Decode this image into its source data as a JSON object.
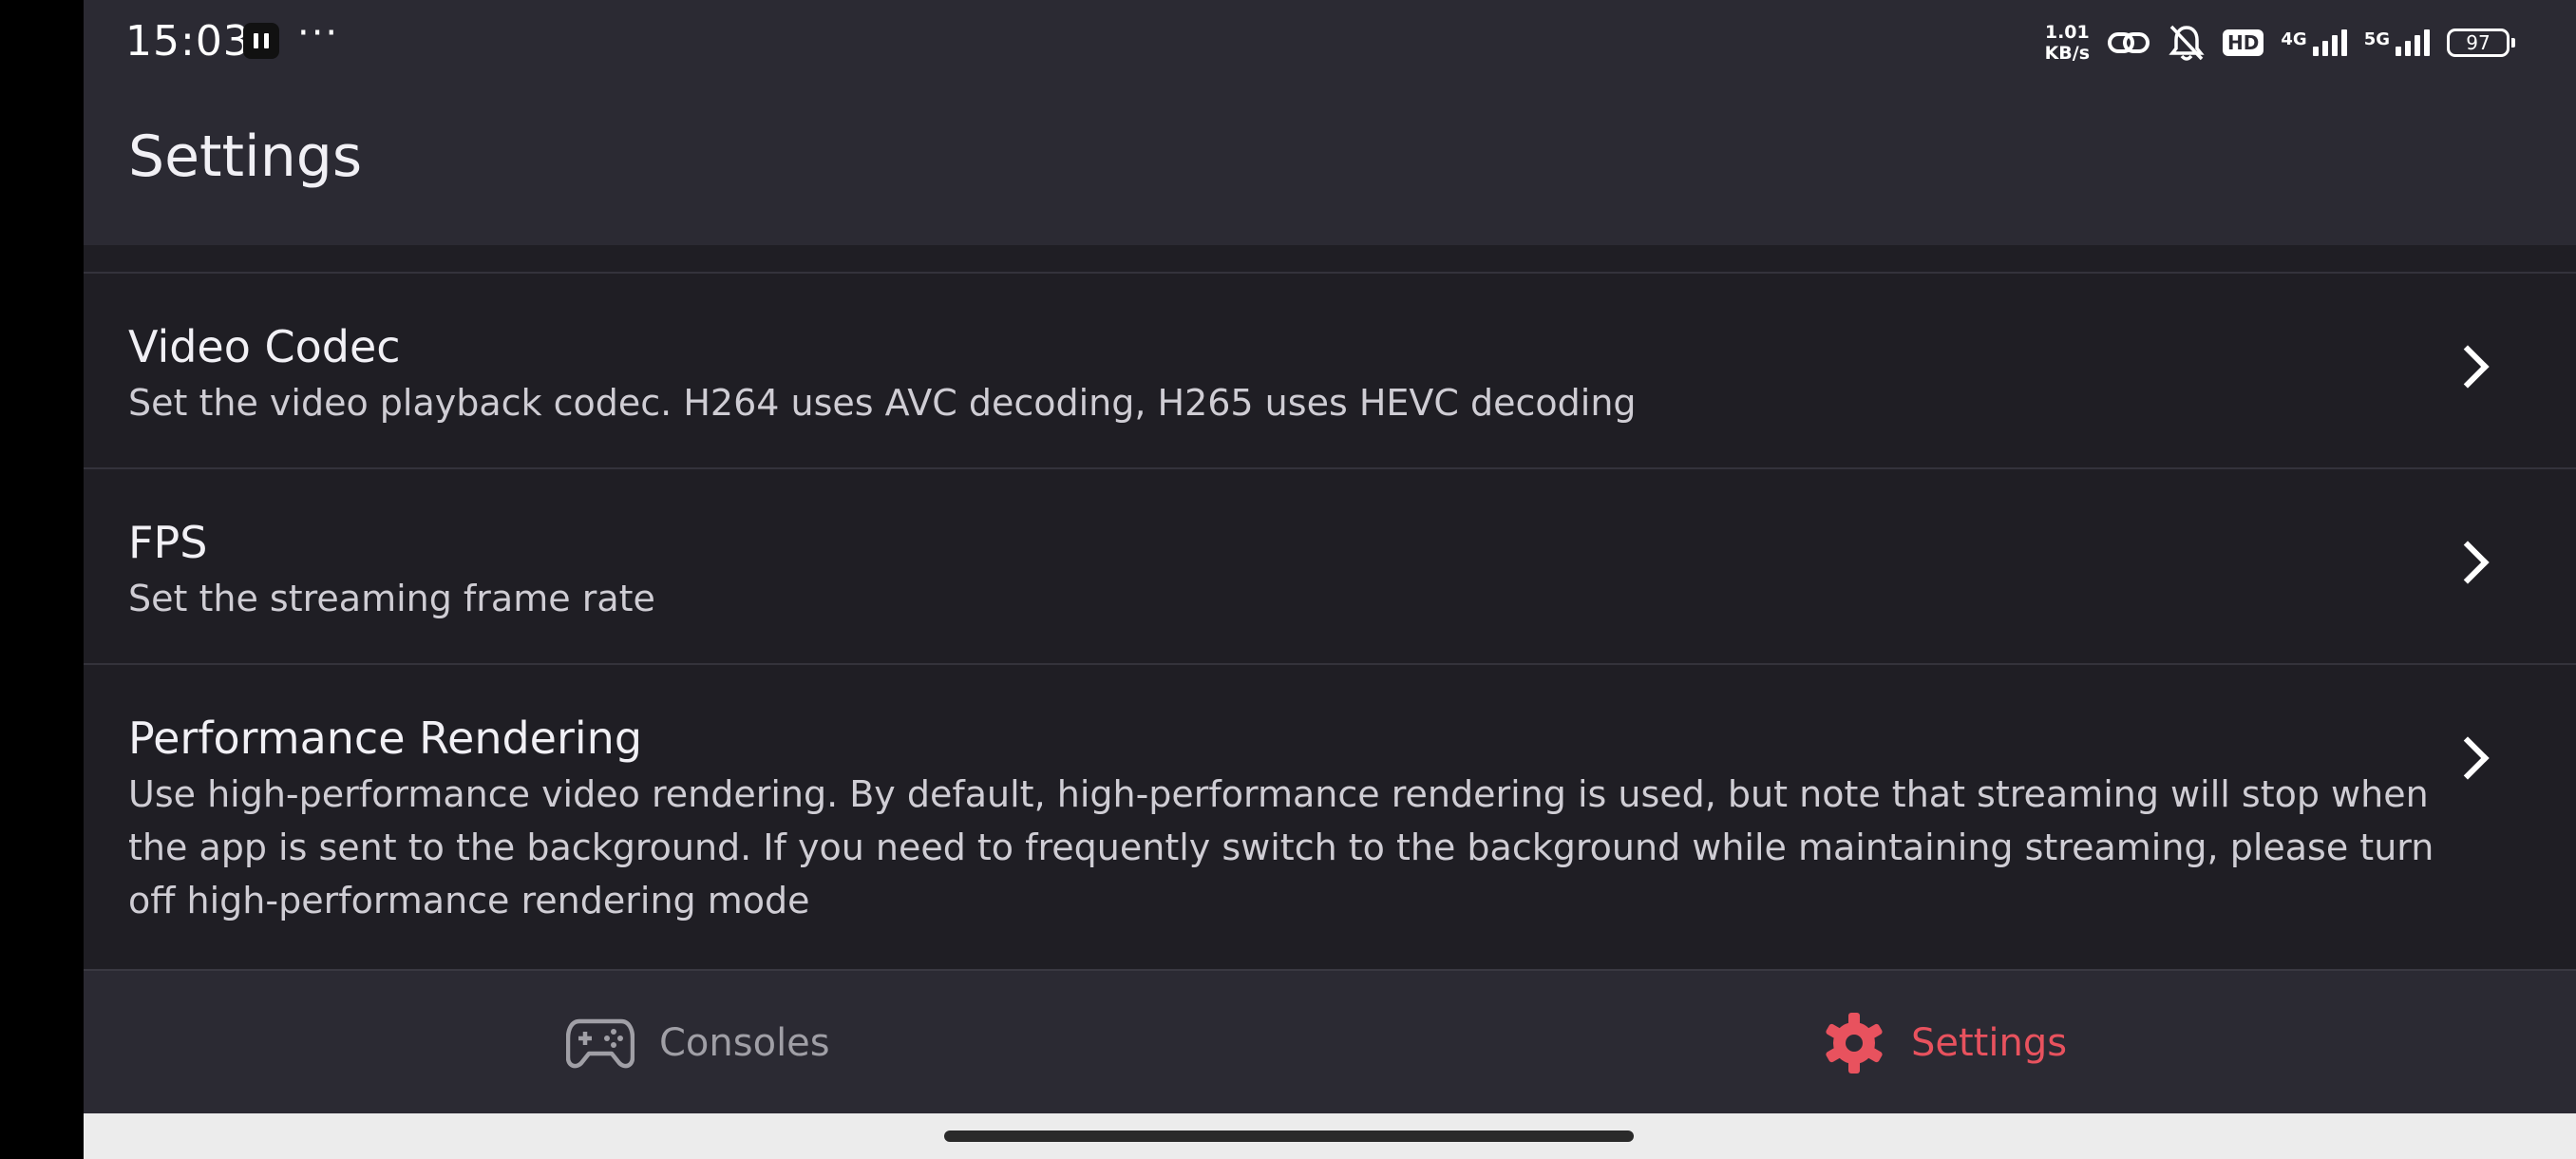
{
  "status_bar": {
    "time": "15:03",
    "more": "···",
    "net_speed_value": "1.01",
    "net_speed_unit": "KB/s",
    "hd_label": "HD",
    "signal_1_label": "4G",
    "signal_2_label": "5G",
    "battery_level": "97",
    "icons": [
      "pause-icon",
      "link-icon",
      "bell-muted-icon",
      "signal-icon",
      "battery-icon"
    ]
  },
  "header": {
    "title": "Settings"
  },
  "settings": [
    {
      "title": "Video Codec",
      "description": "Set the video playback codec. H264 uses AVC decoding, H265 uses HEVC decoding"
    },
    {
      "title": "FPS",
      "description": "Set the streaming frame rate"
    },
    {
      "title": "Performance Rendering",
      "description": "Use high-performance video rendering. By default, high-performance rendering is used, but note that streaming will stop when the app is sent to the background. If you need to frequently switch to the background while maintaining streaming, please turn off high-performance rendering mode"
    }
  ],
  "bottom_nav": {
    "items": [
      {
        "label": "Consoles",
        "icon": "gamepad-icon",
        "active": false
      },
      {
        "label": "Settings",
        "icon": "gear-icon",
        "active": true
      }
    ]
  },
  "colors": {
    "accent": "#e8525e",
    "inactive": "#a09fa6",
    "background": "#1f1e24",
    "bar_background": "#2b2a33"
  }
}
